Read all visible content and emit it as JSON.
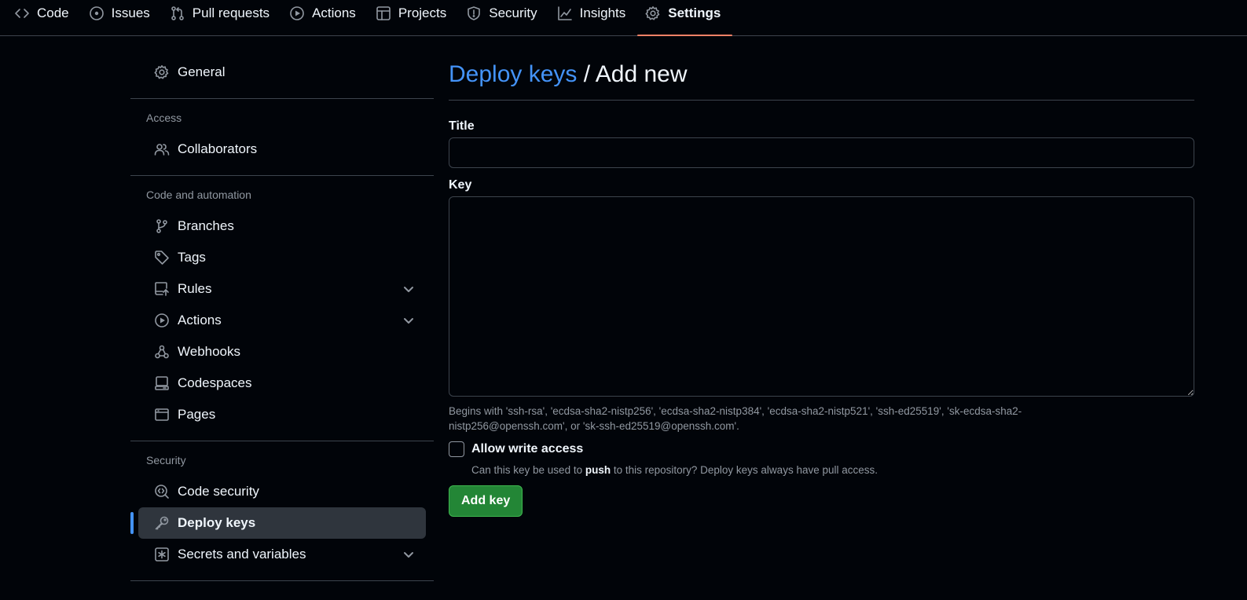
{
  "repo_nav": {
    "tabs": [
      {
        "label": "Code",
        "icon": "code-icon"
      },
      {
        "label": "Issues",
        "icon": "issue-opened-icon"
      },
      {
        "label": "Pull requests",
        "icon": "git-pull-request-icon"
      },
      {
        "label": "Actions",
        "icon": "play-icon"
      },
      {
        "label": "Projects",
        "icon": "table-icon"
      },
      {
        "label": "Security",
        "icon": "shield-icon"
      },
      {
        "label": "Insights",
        "icon": "graph-icon"
      },
      {
        "label": "Settings",
        "icon": "gear-icon",
        "selected": true
      }
    ]
  },
  "sidebar": {
    "general": "General",
    "access_heading": "Access",
    "collaborators": "Collaborators",
    "code_automation_heading": "Code and automation",
    "branches": "Branches",
    "tags": "Tags",
    "rules": "Rules",
    "actions": "Actions",
    "webhooks": "Webhooks",
    "codespaces": "Codespaces",
    "pages": "Pages",
    "security_heading": "Security",
    "code_security": "Code security",
    "deploy_keys": "Deploy keys",
    "secrets_variables": "Secrets and variables"
  },
  "main": {
    "breadcrumb": "Deploy keys",
    "title_separator": " / ",
    "title": "Add new",
    "title_label": "Title",
    "title_value": "",
    "key_label": "Key",
    "key_value": "",
    "key_hint": "Begins with 'ssh-rsa', 'ecdsa-sha2-nistp256', 'ecdsa-sha2-nistp384', 'ecdsa-sha2-nistp521', 'ssh-ed25519', 'sk-ecdsa-sha2-nistp256@openssh.com', or 'sk-ssh-ed25519@openssh.com'.",
    "write_access_label": "Allow write access",
    "write_access_checked": false,
    "write_note_before": "Can this key be used to ",
    "write_note_bold": "push",
    "write_note_after": " to this repository? Deploy keys always have pull access.",
    "add_button": "Add key"
  },
  "colors": {
    "background": "#010409",
    "link": "#4493f8",
    "selected_underline": "#f78166",
    "primary_button": "#238636",
    "active_indicator": "#4493f8"
  }
}
